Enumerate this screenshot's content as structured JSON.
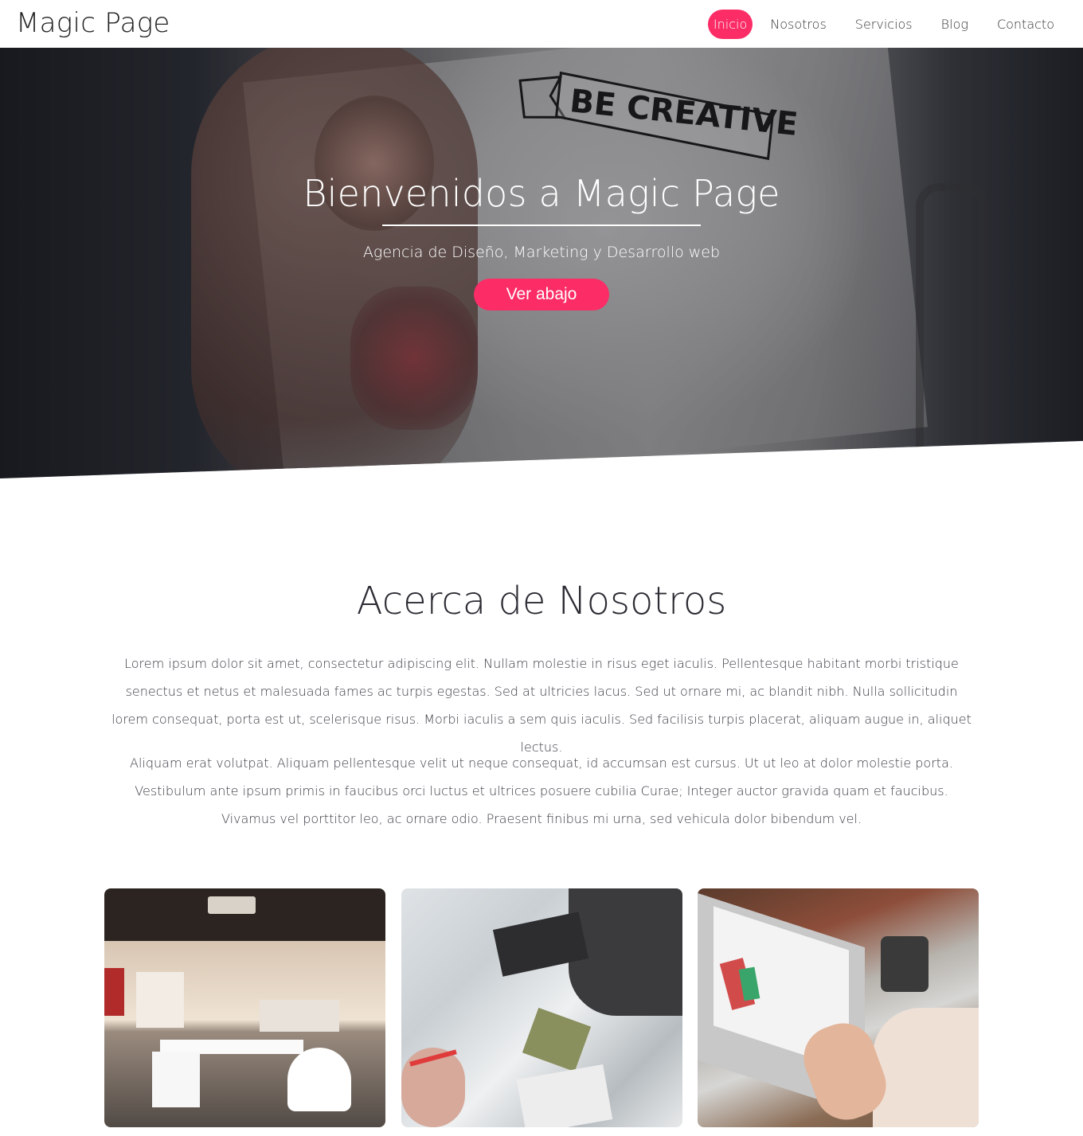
{
  "nav": {
    "brand": "Magic Page",
    "items": [
      {
        "label": "Inicio",
        "active": true
      },
      {
        "label": "Nosotros",
        "active": false
      },
      {
        "label": "Servicios",
        "active": false
      },
      {
        "label": "Blog",
        "active": false
      },
      {
        "label": "Contacto",
        "active": false
      }
    ]
  },
  "hero": {
    "title": "Bienvenidos a Magic Page",
    "subtitle": "Agencia de Diseño, Marketing y Desarrollo web",
    "button_label": "Ver abajo",
    "image_text": "BE CREATIVE"
  },
  "about": {
    "title": "Acerca de Nosotros",
    "paragraphs": [
      "Lorem ipsum dolor sit amet, consectetur adipiscing elit. Nullam molestie in risus eget iaculis. Pellentesque habitant morbi tristique senectus et netus et malesuada fames ac turpis egestas. Sed at ultricies lacus. Sed ut ornare mi, ac blandit nibh. Nulla sollicitudin lorem consequat, porta est ut, scelerisque risus. Morbi iaculis a sem quis iaculis. Sed facilisis turpis placerat, aliquam augue in, aliquet lectus.",
      "Aliquam erat volutpat. Aliquam pellentesque velit ut neque consequat, id accumsan est cursus. Ut ut leo at dolor molestie porta. Vestibulum ante ipsum primis in faucibus orci luctus et ultrices posuere cubilia Curae; Integer auctor gravida quam et faucibus. Vivamus vel porttitor leo, ac ornare odio. Praesent finibus mi urna, sed vehicula dolor bibendum vel."
    ]
  },
  "colors": {
    "accent": "#fc2c66",
    "text": "#2b2b33"
  }
}
